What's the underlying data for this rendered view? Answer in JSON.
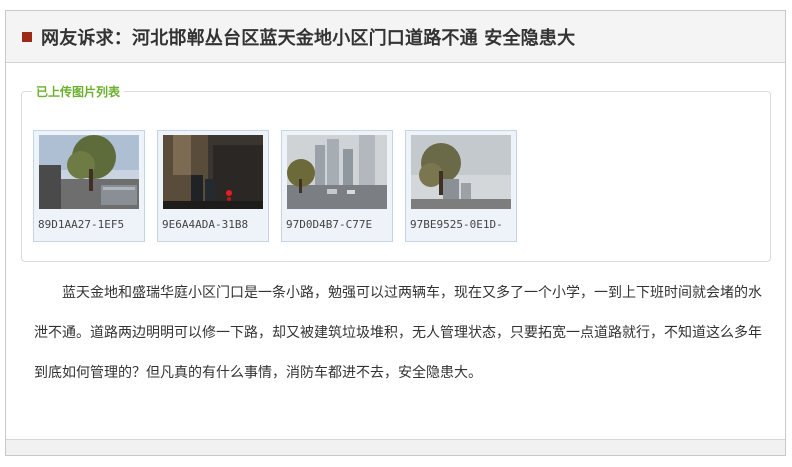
{
  "header": {
    "title": "网友诉求：河北邯郸丛台区蓝天金地小区门口道路不通 安全隐患大"
  },
  "gallery": {
    "legend": "已上传图片列表",
    "images": [
      {
        "caption": "89D1AA27-1EF5"
      },
      {
        "caption": "9E6A4ADA-31B8"
      },
      {
        "caption": "97D0D4B7-C77E"
      },
      {
        "caption": "97BE9525-0E1D-"
      }
    ]
  },
  "content": {
    "paragraph": "蓝天金地和盛瑞华庭小区门口是一条小路，勉强可以过两辆车，现在又多了一个小学，一到上下班时间就会堵的水泄不通。道路两边明明可以修一下路，却又被建筑垃圾堆积，无人管理状态，只要拓宽一点道路就行，不知道这么多年到底如何管理的？但凡真的有什么事情，消防车都进不去，安全隐患大。"
  }
}
